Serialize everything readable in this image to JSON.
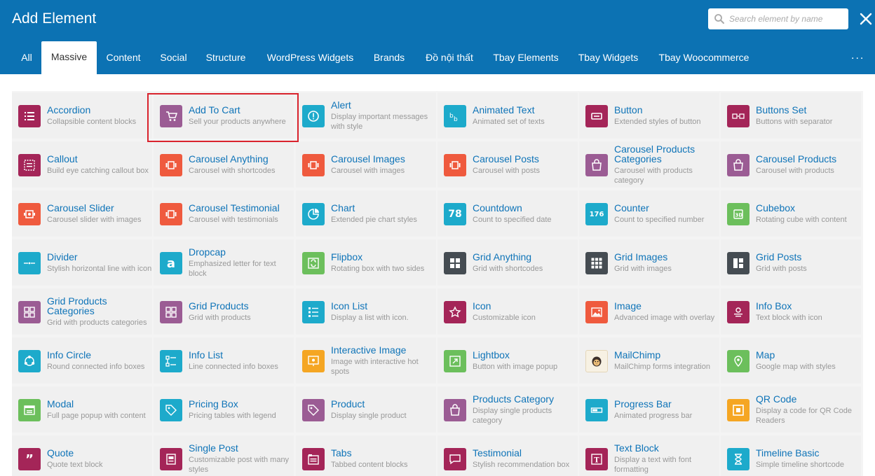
{
  "header": {
    "title": "Add Element",
    "search_placeholder": "Search element by name"
  },
  "tabs": [
    {
      "label": "All"
    },
    {
      "label": "Massive",
      "active": true
    },
    {
      "label": "Content"
    },
    {
      "label": "Social"
    },
    {
      "label": "Structure"
    },
    {
      "label": "WordPress Widgets"
    },
    {
      "label": "Brands"
    },
    {
      "label": "Đồ nội thất"
    },
    {
      "label": "Tbay Elements"
    },
    {
      "label": "Tbay Widgets"
    },
    {
      "label": "Tbay Woocommerce"
    }
  ],
  "more_label": "...",
  "selected_element": "Add To Cart",
  "elements": [
    {
      "name": "Accordion",
      "desc": "Collapsible content blocks",
      "color": "#a42558",
      "icon": "list-icon"
    },
    {
      "name": "Add To Cart",
      "desc": "Sell your products anywhere",
      "color": "#9b5c94",
      "icon": "cart-icon"
    },
    {
      "name": "Alert",
      "desc": "Display important messages with style",
      "color": "#1daacb",
      "icon": "alert-icon"
    },
    {
      "name": "Animated Text",
      "desc": "Animated set of texts",
      "color": "#1daacb",
      "icon": "animated-text-icon"
    },
    {
      "name": "Button",
      "desc": "Extended styles of button",
      "color": "#a42558",
      "icon": "button-icon"
    },
    {
      "name": "Buttons Set",
      "desc": "Buttons with separator",
      "color": "#a42558",
      "icon": "buttons-set-icon"
    },
    {
      "name": "Callout",
      "desc": "Build eye catching callout box",
      "color": "#a42558",
      "icon": "callout-icon"
    },
    {
      "name": "Carousel Anything",
      "desc": "Carousel with shortcodes",
      "color": "#ef5a3e",
      "icon": "carousel-icon"
    },
    {
      "name": "Carousel Images",
      "desc": "Carousel with images",
      "color": "#ef5a3e",
      "icon": "carousel-icon"
    },
    {
      "name": "Carousel Posts",
      "desc": "Carousel with posts",
      "color": "#ef5a3e",
      "icon": "carousel-icon"
    },
    {
      "name": "Carousel Products Categories",
      "desc": "Carousel with products category",
      "color": "#9b5c94",
      "icon": "bag-icon"
    },
    {
      "name": "Carousel Products",
      "desc": "Carousel with products",
      "color": "#9b5c94",
      "icon": "bag-icon"
    },
    {
      "name": "Carousel Slider",
      "desc": "Carousel slider with images",
      "color": "#ef5a3e",
      "icon": "carousel-slider-icon"
    },
    {
      "name": "Carousel Testimonial",
      "desc": "Carousel with testimonials",
      "color": "#ef5a3e",
      "icon": "carousel-icon"
    },
    {
      "name": "Chart",
      "desc": "Extended pie chart styles",
      "color": "#1daacb",
      "icon": "chart-icon"
    },
    {
      "name": "Countdown",
      "desc": "Count to specified date",
      "color": "#1daacb",
      "icon": "countdown-icon",
      "glyph": "78"
    },
    {
      "name": "Counter",
      "desc": "Count to specified number",
      "color": "#1daacb",
      "icon": "counter-icon",
      "glyph": "176"
    },
    {
      "name": "Cubebox",
      "desc": "Rotating cube with content",
      "color": "#6cbf5c",
      "icon": "cube-icon"
    },
    {
      "name": "Divider",
      "desc": "Stylish horizontal line with icon",
      "color": "#1daacb",
      "icon": "divider-icon"
    },
    {
      "name": "Dropcap",
      "desc": "Emphasized letter for text block",
      "color": "#1daacb",
      "icon": "dropcap-icon",
      "glyph": "a"
    },
    {
      "name": "Flipbox",
      "desc": "Rotating box with two sides",
      "color": "#6cbf5c",
      "icon": "flipbox-icon"
    },
    {
      "name": "Grid Anything",
      "desc": "Grid with shortcodes",
      "color": "#454c52",
      "icon": "grid-icon"
    },
    {
      "name": "Grid Images",
      "desc": "Grid with images",
      "color": "#454c52",
      "icon": "grid-images-icon"
    },
    {
      "name": "Grid Posts",
      "desc": "Grid with posts",
      "color": "#454c52",
      "icon": "grid-posts-icon"
    },
    {
      "name": "Grid Products Categories",
      "desc": "Grid with products categories",
      "color": "#9b5c94",
      "icon": "grid-products-icon"
    },
    {
      "name": "Grid Products",
      "desc": "Grid with products",
      "color": "#9b5c94",
      "icon": "grid-products-icon"
    },
    {
      "name": "Icon List",
      "desc": "Display a list with icon.",
      "color": "#1daacb",
      "icon": "icon-list-icon"
    },
    {
      "name": "Icon",
      "desc": "Customizable icon",
      "color": "#a42558",
      "icon": "star-icon"
    },
    {
      "name": "Image",
      "desc": "Advanced image with overlay",
      "color": "#ef5a3e",
      "icon": "image-icon"
    },
    {
      "name": "Info Box",
      "desc": "Text block with icon",
      "color": "#a42558",
      "icon": "info-box-icon"
    },
    {
      "name": "Info Circle",
      "desc": "Round connected info boxes",
      "color": "#1daacb",
      "icon": "info-circle-icon"
    },
    {
      "name": "Info List",
      "desc": "Line connected info boxes",
      "color": "#1daacb",
      "icon": "info-list-icon"
    },
    {
      "name": "Interactive Image",
      "desc": "Image with interactive hot spots",
      "color": "#f5a623",
      "icon": "interactive-image-icon"
    },
    {
      "name": "Lightbox",
      "desc": "Button with image popup",
      "color": "#6cbf5c",
      "icon": "lightbox-icon"
    },
    {
      "name": "MailChimp",
      "desc": "MailChimp forms integration",
      "color": "#f7f1e3",
      "icon": "mailchimp-icon"
    },
    {
      "name": "Map",
      "desc": "Google map with styles",
      "color": "#6cbf5c",
      "icon": "map-pin-icon"
    },
    {
      "name": "Modal",
      "desc": "Full page popup with content",
      "color": "#6cbf5c",
      "icon": "modal-icon"
    },
    {
      "name": "Pricing Box",
      "desc": "Pricing tables with legend",
      "color": "#1daacb",
      "icon": "tag-icon"
    },
    {
      "name": "Product",
      "desc": "Display single product",
      "color": "#9b5c94",
      "icon": "tag-icon"
    },
    {
      "name": "Products Category",
      "desc": "Display single products category",
      "color": "#9b5c94",
      "icon": "bag-icon"
    },
    {
      "name": "Progress Bar",
      "desc": "Animated progress bar",
      "color": "#1daacb",
      "icon": "progress-bar-icon"
    },
    {
      "name": "QR Code",
      "desc": "Display a code for QR Code Readers",
      "color": "#f5a623",
      "icon": "qr-code-icon"
    },
    {
      "name": "Quote",
      "desc": "Quote text block",
      "color": "#a42558",
      "icon": "quote-icon",
      "glyph": "”"
    },
    {
      "name": "Single Post",
      "desc": "Customizable post with many styles",
      "color": "#a42558",
      "icon": "single-post-icon"
    },
    {
      "name": "Tabs",
      "desc": "Tabbed content blocks",
      "color": "#a42558",
      "icon": "tabs-icon"
    },
    {
      "name": "Testimonial",
      "desc": "Stylish recommendation box",
      "color": "#a42558",
      "icon": "testimonial-icon"
    },
    {
      "name": "Text Block",
      "desc": "Display a text with font formatting",
      "color": "#a42558",
      "icon": "text-block-icon"
    },
    {
      "name": "Timeline Basic",
      "desc": "Simple timeline shortcode",
      "color": "#1daacb",
      "icon": "hourglass-icon"
    }
  ]
}
